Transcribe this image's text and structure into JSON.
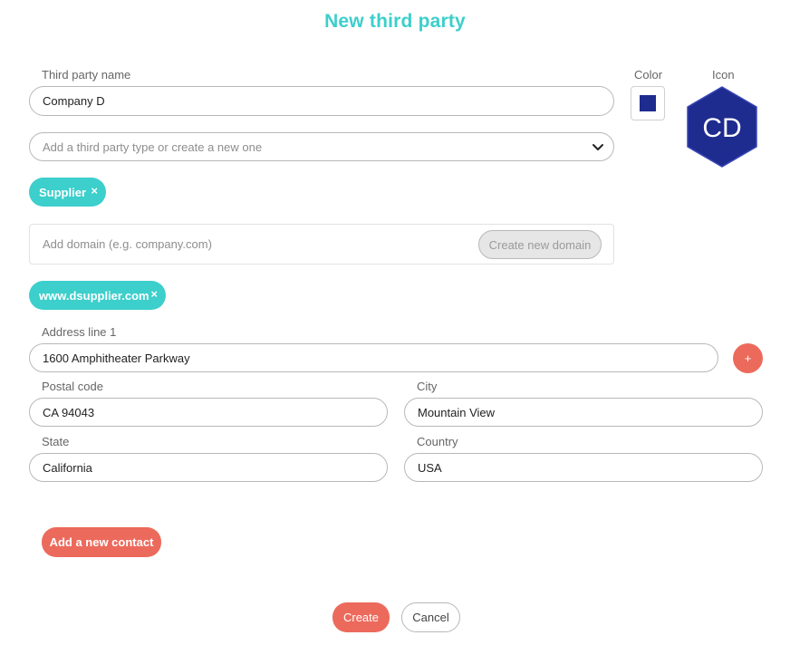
{
  "dialog": {
    "title": "New third party"
  },
  "name_field": {
    "label": "Third party name",
    "value": "Company D"
  },
  "color": {
    "label": "Color",
    "value": "#1e2b8f"
  },
  "icon": {
    "label": "Icon",
    "initials": "CD",
    "fill": "#1e2b8f"
  },
  "type_select": {
    "placeholder": "Add a third party type or create a new one"
  },
  "type_tags": [
    {
      "label": "Supplier",
      "remove": "×"
    }
  ],
  "domain": {
    "placeholder": "Add domain (e.g. company.com)",
    "create_button": "Create new domain",
    "tags": [
      {
        "label": "www.dsupplier.com",
        "remove": "×"
      }
    ]
  },
  "address": {
    "line1_label": "Address line 1",
    "line1_value": "1600 Amphitheater Parkway",
    "add_line_button": "+",
    "postal_label": "Postal code",
    "postal_value": "CA 94043",
    "city_label": "City",
    "city_value": "Mountain View",
    "state_label": "State",
    "state_value": "California",
    "country_label": "Country",
    "country_value": "USA"
  },
  "contact": {
    "add_button": "Add a new contact"
  },
  "actions": {
    "create": "Create",
    "cancel": "Cancel"
  },
  "theme": {
    "accent": "#3ccfcb",
    "danger": "#ec6a5c"
  }
}
